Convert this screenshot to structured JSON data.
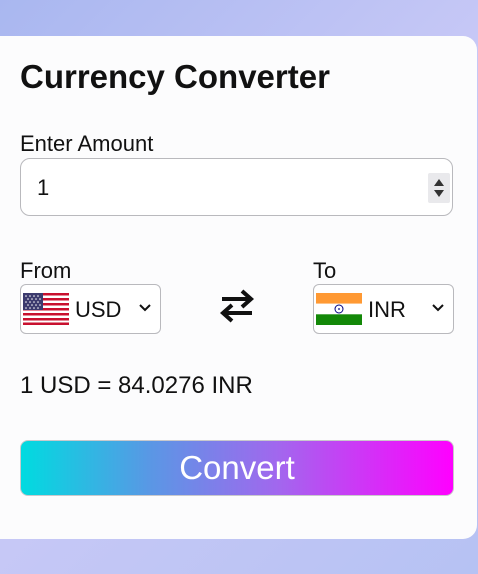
{
  "title": "Currency Converter",
  "amount": {
    "label": "Enter Amount",
    "value": "1"
  },
  "from": {
    "label": "From",
    "currency": "USD",
    "flag": "us-flag-icon"
  },
  "to": {
    "label": "To",
    "currency": "INR",
    "flag": "india-flag-icon"
  },
  "swap_icon": "swap-arrows-icon",
  "result_text": "1 USD = 84.0276 INR",
  "convert_label": "Convert",
  "colors": {
    "gradient_start": "#00dbe0",
    "gradient_end": "#ff00ff"
  }
}
